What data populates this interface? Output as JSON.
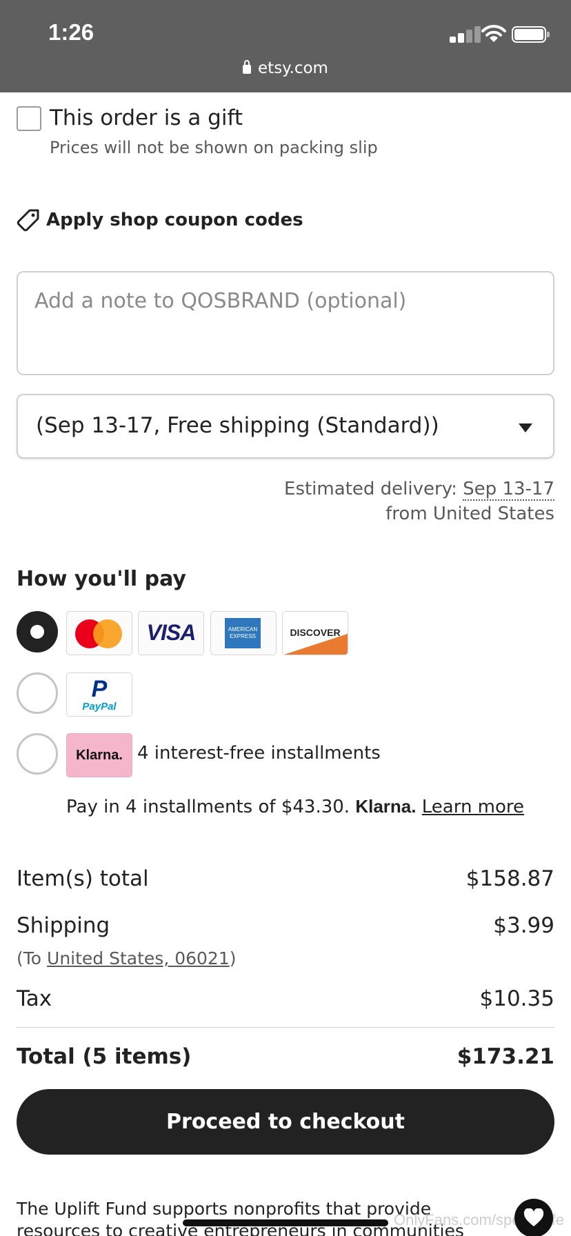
{
  "status_bar": {
    "time": "1:26",
    "url": "etsy.com"
  },
  "gift": {
    "label": "This order is a gift",
    "sublabel": "Prices will not be shown on packing slip",
    "checked": false
  },
  "coupon": {
    "label": "Apply shop coupon codes",
    "icon": "tag-icon"
  },
  "note": {
    "placeholder": "Add a note to QOSBRAND (optional)",
    "value": ""
  },
  "shipping_option": {
    "selected": "(Sep 13-17, Free shipping (Standard))"
  },
  "delivery": {
    "estimated_label": "Estimated delivery:",
    "estimated_date": "Sep 13-17",
    "from": "from United States"
  },
  "payment": {
    "title": "How you'll pay",
    "options": [
      {
        "id": "cards",
        "selected": true,
        "cards": [
          "Mastercard",
          "VISA",
          "AMERICAN EXPRESS",
          "DISCOVER"
        ]
      },
      {
        "id": "paypal",
        "selected": false,
        "logo_text": "P",
        "logo_word": "PayPal"
      },
      {
        "id": "klarna",
        "selected": false,
        "logo_text": "Klarna.",
        "label": "4 interest-free installments"
      }
    ],
    "klarna_note": {
      "text": "Pay in 4 installments of $43.30.",
      "brand": "Klarna.",
      "link": "Learn more"
    }
  },
  "summary": {
    "items_total_label": "Item(s) total",
    "items_total_value": "$158.87",
    "shipping_label": "Shipping",
    "shipping_value": "$3.99",
    "shipping_to_prefix": "(To ",
    "shipping_to_link": "United States, 06021",
    "shipping_to_suffix": ")",
    "tax_label": "Tax",
    "tax_value": "$10.35",
    "total_label": "Total (5 items)",
    "total_value": "$173.21"
  },
  "checkout": {
    "button_label": "Proceed to checkout"
  },
  "footer": {
    "uplift_text": "The Uplift Fund supports nonprofits that provide resources to creative entrepreneurs in communities",
    "watermark": "OnlyFans.com/sportywife"
  },
  "colors": {
    "status_bar": "#5f5f5f",
    "primary_button": "#222222",
    "klarna_pink": "#f5b6cc",
    "text_muted": "#595959"
  }
}
